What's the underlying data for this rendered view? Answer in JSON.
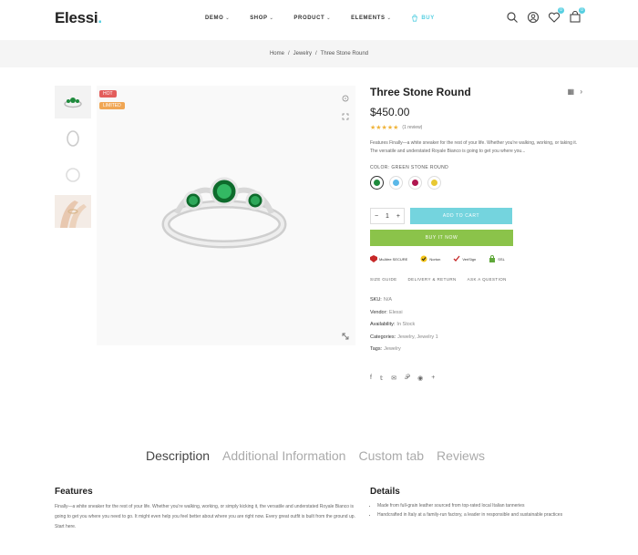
{
  "header": {
    "logo": "Elessi",
    "logo_dot": ".",
    "nav": [
      {
        "label": "DEMO",
        "chevron": true
      },
      {
        "label": "SHOP",
        "chevron": true
      },
      {
        "label": "PRODUCT",
        "chevron": true
      },
      {
        "label": "ELEMENTS",
        "chevron": true
      },
      {
        "label": "BUY",
        "chevron": false
      }
    ],
    "wishlist_count": "0",
    "cart_count": "0"
  },
  "breadcrumb": {
    "home": "Home",
    "sep": "/",
    "category": "Jewelry",
    "current": "Three Stone Round"
  },
  "gallery": {
    "labels": {
      "hot": "HOT",
      "sale": "LIMITED"
    }
  },
  "product": {
    "title": "Three Stone Round",
    "price": "$450.00",
    "rating_stars": "★★★★★",
    "reviews": "(1 review)",
    "description": "Features Finally—a white sneaker for the rest of your life. Whether you're walking, working, or taking it. The versatile and understated Royale Bianco is going to get you where you...",
    "color_label": "COLOR: GREEN STONE ROUND",
    "quantity": "1",
    "add_to_cart": "ADD TO CART",
    "buy_now": "BUY IT NOW",
    "trust_badges": [
      "McAfee SECURE",
      "Norton",
      "VeriSign",
      "SSL"
    ],
    "extra_links": [
      "SIZE GUIDE",
      "DELIVERY & RETURN",
      "ASK A QUESTION"
    ],
    "meta": [
      {
        "key": "SKU:",
        "value": "N/A"
      },
      {
        "key": "Vendor:",
        "value": "Elessi"
      },
      {
        "key": "Availability:",
        "value": "In Stock"
      },
      {
        "key": "Categories:",
        "value": "Jewelry, Jewelry 1"
      },
      {
        "key": "Tags:",
        "value": "Jewelry"
      }
    ]
  },
  "tabs": [
    "Description",
    "Additional Information",
    "Custom tab",
    "Reviews"
  ],
  "features": {
    "heading": "Features",
    "text": "Finally—a white sneaker for the rest of your life. Whether you're walking, working, or simply kicking it, the versatile and understated Royale Bianco is going to get you where you need to go. It might even help you feel better about where you are right now. Every great outfit is built from the ground up. Start here."
  },
  "details": {
    "heading": "Details",
    "items": [
      "Made from full-grain leather sourced from top-rated local Italian tanneries",
      "Handcrafted in Italy at a family-run factory, a leader in responsible and sustainable practices"
    ]
  },
  "colors": {
    "accent": "#56cfe1",
    "cart": "#74d4de",
    "buy": "#8bc34a",
    "hot": "#e35d5b",
    "sale": "#f0a654"
  }
}
